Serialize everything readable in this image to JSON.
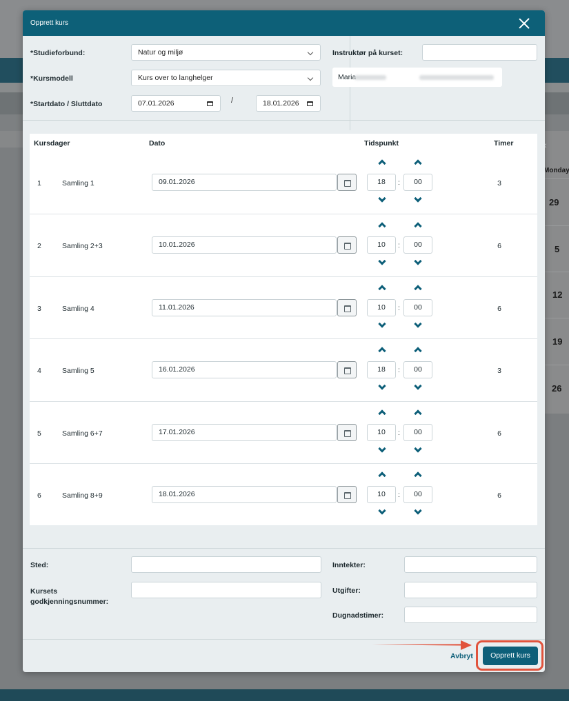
{
  "background": {
    "calendar": {
      "day_header": "Monday",
      "dates": [
        "29",
        "5",
        "12",
        "19",
        "26"
      ]
    }
  },
  "modal": {
    "title": "Opprett kurs",
    "study_association": {
      "label": "*Studieforbund:",
      "value": "Natur og miljø"
    },
    "course_model": {
      "label": "*Kursmodell",
      "value": "Kurs over to langhelger"
    },
    "dates": {
      "label": "*Startdato / Sluttdato",
      "start": "07.01.2026",
      "separator": "/",
      "end": "18.01.2026"
    },
    "instructor": {
      "label": "Instruktør på kurset:",
      "input_value": "",
      "selected_name": "Maria"
    },
    "table": {
      "headers": {
        "day": "Kursdager",
        "date": "Dato",
        "time": "Tidspunkt",
        "hours": "Timer"
      },
      "rows": [
        {
          "num": "1",
          "name": "Samling 1",
          "date": "09.01.2026",
          "hour": "18",
          "minute": "00",
          "hours": "3"
        },
        {
          "num": "2",
          "name": "Samling 2+3",
          "date": "10.01.2026",
          "hour": "10",
          "minute": "00",
          "hours": "6"
        },
        {
          "num": "3",
          "name": "Samling 4",
          "date": "11.01.2026",
          "hour": "10",
          "minute": "00",
          "hours": "6"
        },
        {
          "num": "4",
          "name": "Samling 5",
          "date": "16.01.2026",
          "hour": "18",
          "minute": "00",
          "hours": "3"
        },
        {
          "num": "5",
          "name": "Samling 6+7",
          "date": "17.01.2026",
          "hour": "10",
          "minute": "00",
          "hours": "6"
        },
        {
          "num": "6",
          "name": "Samling 8+9",
          "date": "18.01.2026",
          "hour": "10",
          "minute": "00",
          "hours": "6"
        }
      ],
      "time_separator": ":"
    },
    "location": {
      "label": "Sted:",
      "value": ""
    },
    "approval_number": {
      "label": "Kursets godkjenningsnummer:",
      "value": ""
    },
    "income": {
      "label": "Inntekter:",
      "value": ""
    },
    "expenses": {
      "label": "Utgifter:",
      "value": ""
    },
    "volunteer_hours": {
      "label": "Dugnadstimer:",
      "value": ""
    },
    "footer": {
      "cancel_label": "Avbryt",
      "submit_label": "Opprett kurs"
    }
  },
  "colors": {
    "primary": "#0d6078",
    "highlight": "#e1533c"
  }
}
